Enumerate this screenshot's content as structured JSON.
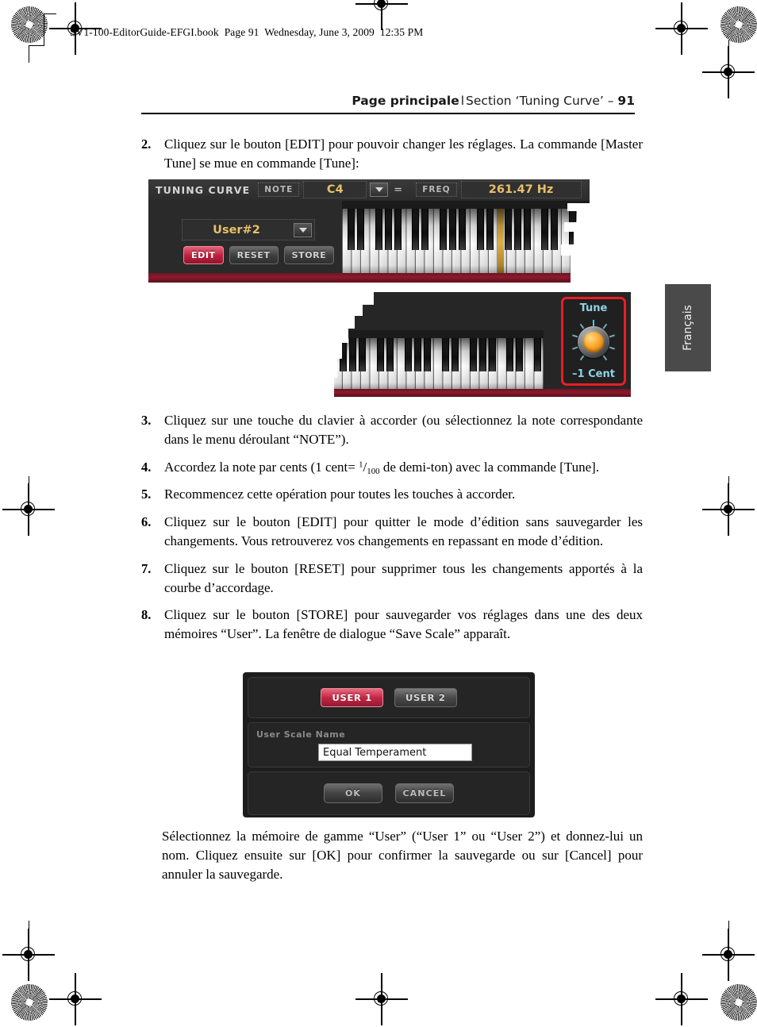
{
  "file_stamp": "SV1-100-EditorGuide-EFGI.book  Page 91  Wednesday, June 3, 2009  12:35 PM",
  "header": {
    "title": "Page principale",
    "separator": "l",
    "section": "Section ‘Tuning Curve’ –",
    "page_number": "91"
  },
  "language_tab": {
    "label": "Français"
  },
  "steps": [
    {
      "number": "2.",
      "text": "Cliquez sur le bouton [EDIT] pour pouvoir changer les réglages. La commande [Master Tune] se mue en commande [Tune]:"
    },
    {
      "number": "3.",
      "text": "Cliquez sur une touche du clavier à accorder (ou sélectionnez la note correspondante dans le menu déroulant “NOTE”)."
    },
    {
      "number": "4.",
      "text_before": "Accordez la note par cents (1 cent= ",
      "fraction_numerator": "1",
      "fraction_denominator": "100",
      "text_after": " de demi-ton) avec la commande [Tune]."
    },
    {
      "number": "5.",
      "text": "Recommencez cette opération pour toutes les touches à accorder."
    },
    {
      "number": "6.",
      "text": "Cliquez sur le bouton [EDIT] pour quitter le mode d’édition sans sauvegarder les changements. Vous retrouverez vos changements en repassant en mode d’édition."
    },
    {
      "number": "7.",
      "text": "Cliquez sur le bouton [RESET] pour supprimer tous les changements apportés à la courbe d’accordage."
    },
    {
      "number": "8.",
      "text": "Cliquez sur le bouton [STORE] pour sauvegarder vos réglages dans une des deux mémoires “User”. La fenêtre de dialogue “Save Scale” apparaît."
    }
  ],
  "closing_paragraph": "Sélectionnez la mémoire de gamme “User” (“User 1” ou “User 2”) et donnez-lui un nom. Cliquez ensuite sur [OK] pour confirmer la sauvegarde ou sur [Cancel] pour annuler la sauvegarde.",
  "figure_tuning_curve": {
    "panel_title": "TUNING CURVE",
    "note_label": "NOTE",
    "note_value": "C4",
    "equals": "=",
    "freq_label": "FREQ",
    "freq_value": "261.47 Hz",
    "scale_selector_value": "User#2",
    "buttons": [
      {
        "label": "EDIT",
        "selected": true
      },
      {
        "label": "RESET",
        "selected": false
      },
      {
        "label": "STORE",
        "selected": false
      }
    ],
    "accent_gold": "#e8c06a",
    "accent_red": "#bf2240"
  },
  "figure_tune_knob": {
    "title": "Tune",
    "value": "–1 Cent",
    "highlight_color": "#ec1c24",
    "label_color": "#8fd2e8",
    "knob_color": "#f9a72c"
  },
  "figure_save_scale": {
    "user_buttons": [
      {
        "label": "USER 1",
        "selected": true
      },
      {
        "label": "USER 2",
        "selected": false
      }
    ],
    "field_label": "User Scale Name",
    "field_value": "Equal Temperament",
    "ok_label": "OK",
    "cancel_label": "CANCEL"
  }
}
